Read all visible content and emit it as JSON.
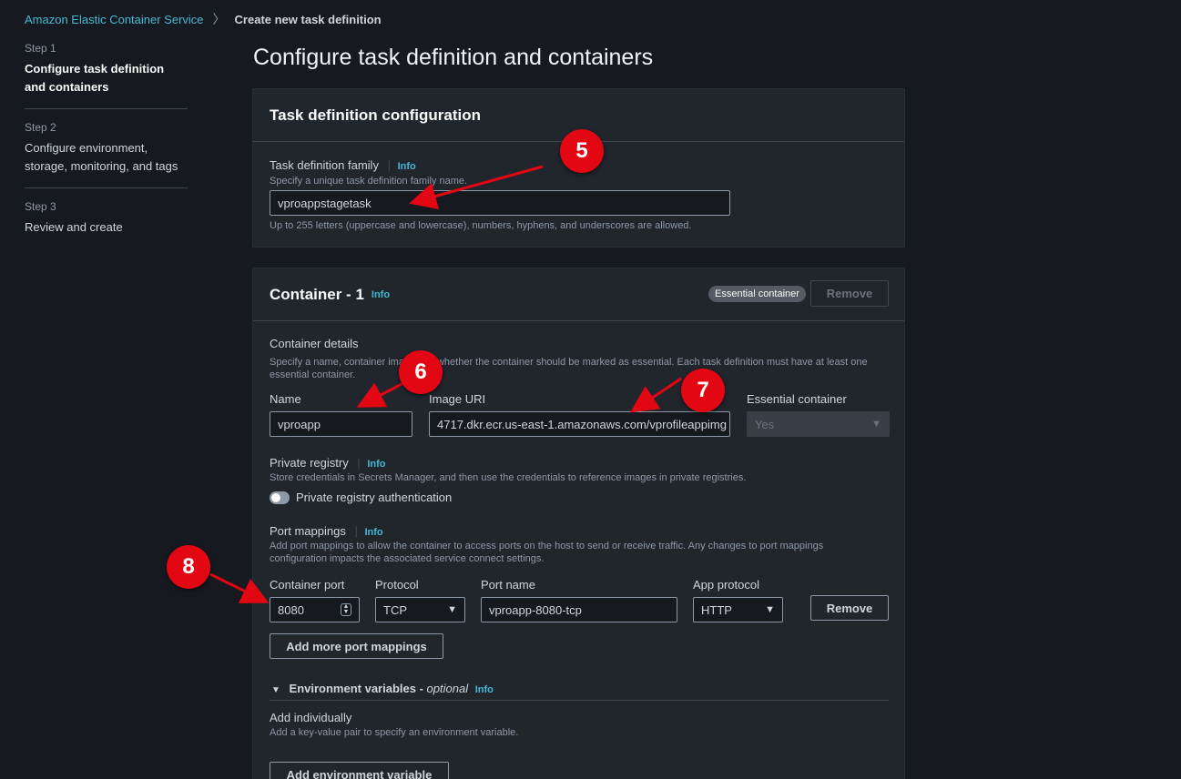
{
  "breadcrumb": {
    "root": "Amazon Elastic Container Service",
    "current": "Create new task definition"
  },
  "steps": [
    {
      "num": "Step 1",
      "title": "Configure task definition and containers"
    },
    {
      "num": "Step 2",
      "title": "Configure environment, storage, monitoring, and tags"
    },
    {
      "num": "Step 3",
      "title": "Review and create"
    }
  ],
  "page_title": "Configure task definition and containers",
  "task_config": {
    "header": "Task definition configuration",
    "family_label": "Task definition family",
    "info": "Info",
    "family_desc": "Specify a unique task definition family name.",
    "family_value": "vproappstagetask",
    "family_hint": "Up to 255 letters (uppercase and lowercase), numbers, hyphens, and underscores are allowed."
  },
  "container": {
    "header": "Container - 1",
    "info": "Info",
    "essential_badge": "Essential container",
    "remove_label": "Remove",
    "details_label": "Container details",
    "details_desc_1": "Specify a name, container ima",
    "details_desc_2": "whether the container should be marked as essential. Each task definition must have at least one",
    "details_desc_3": "essential container.",
    "name_label": "Name",
    "name_value": "vproapp",
    "image_label": "Image URI",
    "image_value": "4717.dkr.ecr.us-east-1.amazonaws.com/vprofileappimg",
    "essential_label": "Essential container",
    "essential_value": "Yes",
    "private_label": "Private registry",
    "private_desc": "Store credentials in Secrets Manager, and then use the credentials to reference images in private registries.",
    "private_toggle_label": "Private registry authentication",
    "port_label": "Port mappings",
    "port_desc_1": "Add port mappings to allow the container to access ports on the host to send or receive traffic. Any changes to port mappings",
    "port_desc_2": "configuration impacts the associated service connect settings.",
    "container_port_label": "Container port",
    "container_port_value": "8080",
    "protocol_label": "Protocol",
    "protocol_value": "TCP",
    "port_name_label": "Port name",
    "port_name_value": "vproapp-8080-tcp",
    "app_protocol_label": "App protocol",
    "app_protocol_value": "HTTP",
    "port_remove_label": "Remove",
    "add_port_label": "Add more port mappings",
    "env_label": "Environment variables -",
    "env_optional": "optional",
    "add_individually_label": "Add individually",
    "add_individually_desc": "Add a key-value pair to specify an environment variable.",
    "add_env_label": "Add environment variable"
  },
  "callouts": [
    "5",
    "6",
    "7",
    "8"
  ],
  "colors": {
    "accent": "#44b9d6",
    "callout": "#e30613",
    "background": "#16191f",
    "panel": "#21252c"
  }
}
